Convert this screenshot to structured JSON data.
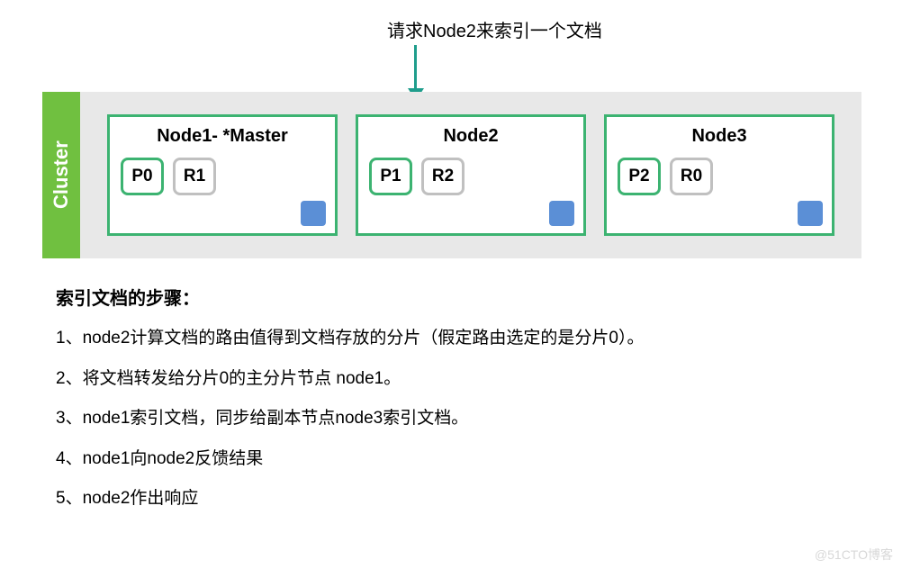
{
  "request_label": "请求Node2来索引一个文档",
  "cluster_label": "Cluster",
  "nodes": [
    {
      "title": "Node1- *Master",
      "primary": "P0",
      "replica": "R1"
    },
    {
      "title": "Node2",
      "primary": "P1",
      "replica": "R2"
    },
    {
      "title": "Node3",
      "primary": "P2",
      "replica": "R0"
    }
  ],
  "steps": {
    "title": "索引文档的步骤：",
    "items": [
      "1、node2计算文档的路由值得到文档存放的分片（假定路由选定的是分片0）。",
      "2、将文档转发给分片0的主分片节点 node1。",
      "3、node1索引文档，同步给副本节点node3索引文档。",
      "4、node1向node2反馈结果",
      "5、node2作出响应"
    ]
  },
  "watermark": "@51CTO博客"
}
